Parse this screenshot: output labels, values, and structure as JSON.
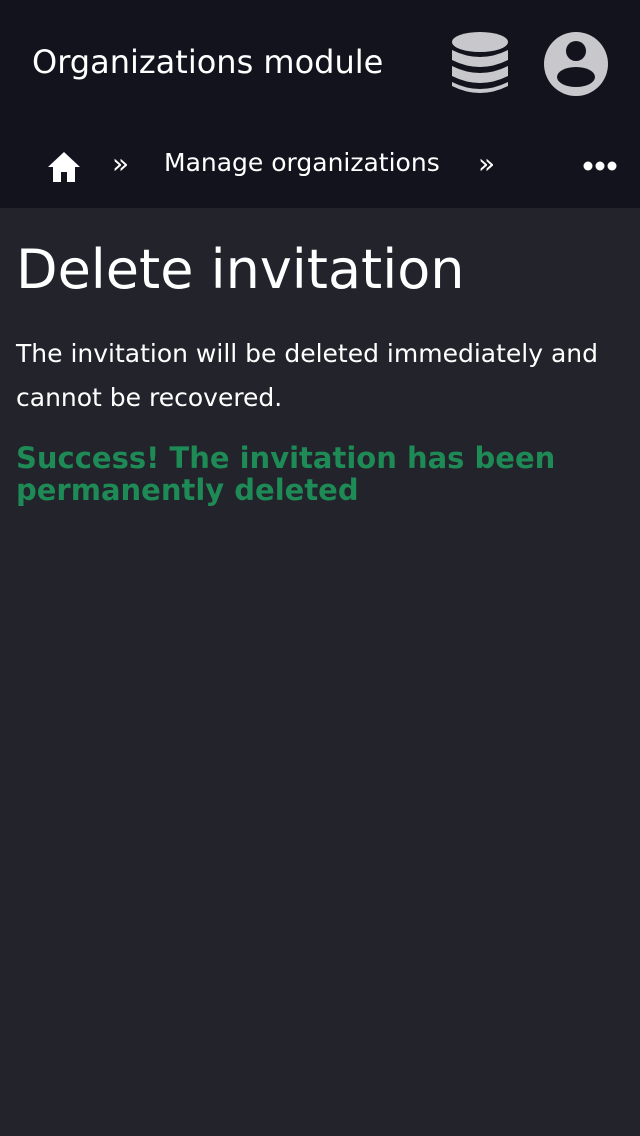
{
  "header": {
    "title": "Organizations module",
    "icons": [
      "database-icon",
      "user-account-icon"
    ]
  },
  "breadcrumb": {
    "home_icon": "home-icon",
    "separator": "»",
    "items": [
      {
        "label": "Manage organizations"
      }
    ],
    "more_icon": "ellipsis-icon"
  },
  "main": {
    "title": "Delete invitation",
    "description": "The invitation will be deleted immediately and cannot be recovered.",
    "success_message": "Success! The invitation has been permanently deleted"
  },
  "colors": {
    "header_background": "#12131c",
    "page_background": "#22232b",
    "text": "#ffffff",
    "icon_gray": "#c8c8cc",
    "success_green": "#1e8a55"
  }
}
